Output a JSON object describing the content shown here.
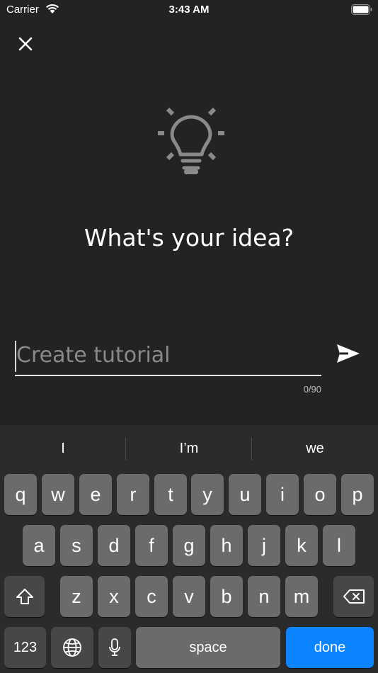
{
  "status_bar": {
    "carrier": "Carrier",
    "time": "3:43 AM"
  },
  "icons": {
    "close": "close-icon",
    "bulb": "lightbulb-icon",
    "send": "send-icon",
    "shift": "shift-icon",
    "delete": "backspace-icon",
    "globe": "globe-icon",
    "mic": "microphone-icon",
    "wifi": "wifi-icon",
    "battery": "battery-icon"
  },
  "prompt": "What's your idea?",
  "input": {
    "placeholder": "Create tutorial",
    "value": "",
    "counter": "0/90"
  },
  "colors": {
    "background": "#232323",
    "accent": "#0a84ff",
    "keyboard": "#2b2b2b"
  },
  "keyboard": {
    "suggestions": [
      "I",
      "I’m",
      "we"
    ],
    "row1": [
      "q",
      "w",
      "e",
      "r",
      "t",
      "y",
      "u",
      "i",
      "o",
      "p"
    ],
    "row2": [
      "a",
      "s",
      "d",
      "f",
      "g",
      "h",
      "j",
      "k",
      "l"
    ],
    "row3": [
      "z",
      "x",
      "c",
      "v",
      "b",
      "n",
      "m"
    ],
    "numbers_label": "123",
    "space_label": "space",
    "done_label": "done"
  }
}
